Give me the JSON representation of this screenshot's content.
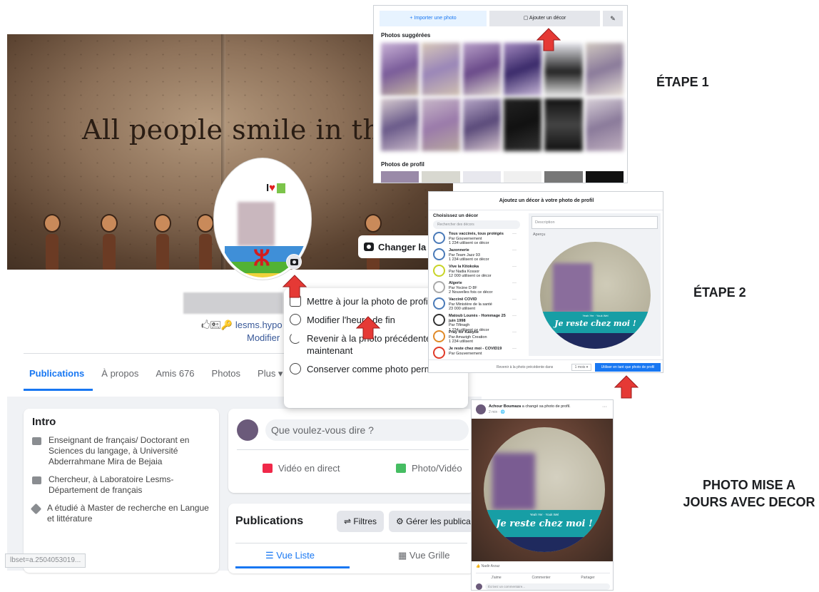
{
  "cover": {
    "quote": "All people smile in the same l",
    "change_cover_label": "Changer la pho"
  },
  "profile": {
    "avatar_text_i": "I",
    "avatar_text_heart": "♥",
    "avatar_yaz": "ⵣ",
    "name_initial": "I",
    "bio": "lesms.hypo",
    "bio_emoji": "🖒🖭🔑",
    "edit": "Modifier"
  },
  "tabs": [
    "Publications",
    "À propos",
    "Amis 676",
    "Photos",
    "Plus ▾"
  ],
  "intro": {
    "title": "Intro",
    "items": [
      "Enseignant de français/ Doctorant en Sciences du langage, à Université Abderrahmane Mira de Bejaia",
      "Chercheur, à Laboratoire Lesms-Département de français",
      "A étudié à Master de recherche en Langue et littérature"
    ]
  },
  "status_url": "lbset=a.2504053019...",
  "composer": {
    "placeholder": "Que voulez-vous dire ?",
    "live": "Vidéo en direct",
    "photo": "Photo/Vidéo"
  },
  "publications": {
    "title": "Publications",
    "filters": "Filtres",
    "manage": "Gérer les publica",
    "list_view": "Vue Liste",
    "grid_view": "Vue Grille"
  },
  "menu": {
    "items": [
      "Mettre à jour la photo de profil",
      "Modifier l'heure de fin",
      "Revenir à la photo précédente maintenant",
      "Conserver comme photo permanente"
    ]
  },
  "panel1": {
    "tab_import": "+ Importer une photo",
    "tab_frame": "Ajouter un décor",
    "suggested": "Photos suggérées",
    "profile_photos": "Photos de profil"
  },
  "panel2": {
    "title": "Ajoutez un décor à votre photo de profil",
    "choose": "Choisissez un décor",
    "search": "Rechercher des décors",
    "frames": [
      {
        "name": "Tous vaccinés, tous protégés",
        "by": "Par Gouvernement",
        "n": "1 234 utilisent ce décor"
      },
      {
        "name": "Jazonnerie",
        "by": "Par Team Jazz 93",
        "n": "1 234 utilisent ce décor"
      },
      {
        "name": "Vive la Kitokoka",
        "by": "Par Nadia Kossor",
        "n": "12 000 utilisent ce décor"
      },
      {
        "name": "Algerie",
        "by": "Par Yocine D 8F",
        "n": "2 Nouvelles fois ce décor"
      },
      {
        "name": "Vaccinë COVID",
        "by": "Par Ministère de la santé",
        "n": "23 000 utilisent"
      },
      {
        "name": "Matoub Lounès - Hommage 25 juin 1998",
        "by": "Par Tifinagh",
        "n": "1 234 utilisent ce décor"
      },
      {
        "name": "Pray for Kabylie",
        "by": "Par Amazigh Creation",
        "n": "1 234 utilisent"
      },
      {
        "name": "Je reste chez moi - COVID19",
        "by": "Par Gouvernement",
        "n": ""
      }
    ],
    "description": "Description",
    "apercu": "Aperçu",
    "preview_t1": "Yeah Yer · Youk Wel",
    "preview_t2": "Je reste chez moi !",
    "footer_text": "Revenir à la photo précédente dans",
    "footer_select": "1 mois ▾",
    "footer_button": "Utiliser en tant que photo de profil"
  },
  "panel3": {
    "author": "Achour Boumaza",
    "action": " a changé sa photo de profil.",
    "time": "2 min · 🌐",
    "preview_t1": "Yeah Yer · Youk Wel",
    "preview_t2": "Je reste chez moi !",
    "reactions": "Nadir Arzaz",
    "like": "J'aime",
    "comment": "Commenter",
    "share": "Partager",
    "write": "Écrivez un commentaire..."
  },
  "labels": {
    "step1": "ÉTAPE 1",
    "step2": "ÉTAPE 2",
    "result": "PHOTO MISE A JOURS AVEC DECOR"
  },
  "colors": {
    "accent": "#1877f2",
    "arrow": "#e53935",
    "frame_teal": "#179ea5"
  }
}
